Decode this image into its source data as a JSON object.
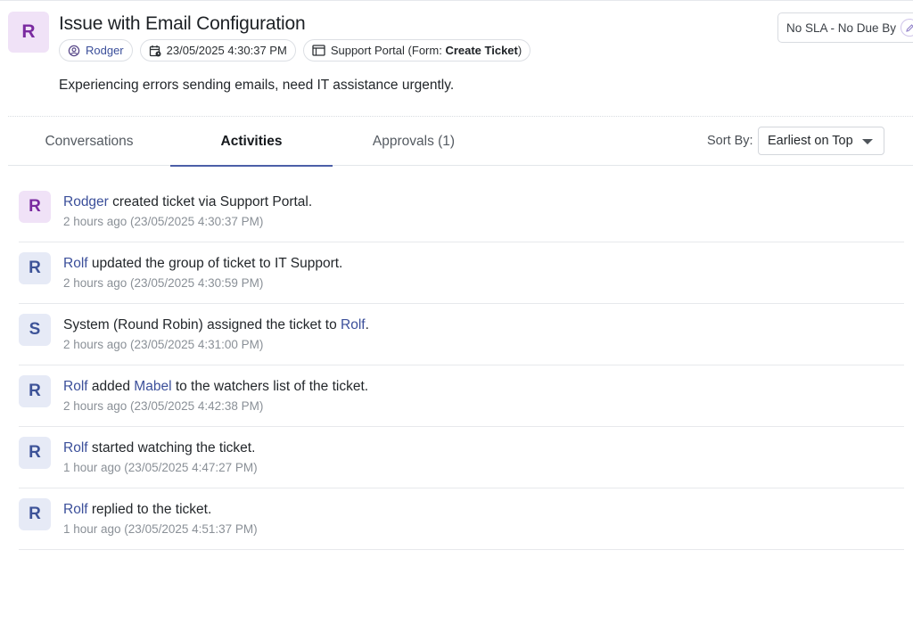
{
  "ticket": {
    "avatar_initial": "R",
    "title": "Issue with Email Configuration",
    "requester": "Rodger",
    "created_at": "23/05/2025 4:30:37 PM",
    "source": "Support Portal",
    "form_prefix": "(Form: ",
    "form_name": "Create Ticket",
    "form_suffix": ")",
    "description": "Experiencing errors sending emails, need IT assistance urgently.",
    "sla": "No SLA - No Due By"
  },
  "tabs": {
    "conversations": "Conversations",
    "activities": "Activities",
    "approvals": "Approvals (1)"
  },
  "sort": {
    "label": "Sort By:",
    "value": "Earliest on Top"
  },
  "activities": [
    {
      "initial": "R",
      "actor": "Rodger",
      "text": " created ticket via Support Portal.",
      "time": "2 hours ago (23/05/2025 4:30:37 PM)"
    },
    {
      "initial": "R",
      "actor": "Rolf",
      "text": " updated the group of ticket to IT Support.",
      "time": "2 hours ago (23/05/2025 4:30:59 PM)"
    },
    {
      "initial": "S",
      "prefix": "System (Round Robin) assigned the ticket to ",
      "target": "Rolf",
      "suffix": ".",
      "time": "2 hours ago (23/05/2025 4:31:00 PM)"
    },
    {
      "initial": "R",
      "actor": "Rolf",
      "middle": " added ",
      "target": "Mabel",
      "suffix": " to the watchers list of the ticket.",
      "time": "2 hours ago (23/05/2025 4:42:38 PM)"
    },
    {
      "initial": "R",
      "actor": "Rolf",
      "text": " started watching the ticket.",
      "time": "1 hour ago (23/05/2025 4:47:27 PM)"
    },
    {
      "initial": "R",
      "actor": "Rolf",
      "text": " replied to the ticket.",
      "time": "1 hour ago (23/05/2025 4:51:37 PM)"
    }
  ],
  "colors": {
    "link": "#3b4f9a",
    "accent": "#4c5fa8",
    "requester_avatar_bg": "#f0e2f7",
    "requester_avatar_fg": "#7a2aa0",
    "user_avatar_bg": "#e6eaf6",
    "user_avatar_fg": "#3d5398"
  }
}
